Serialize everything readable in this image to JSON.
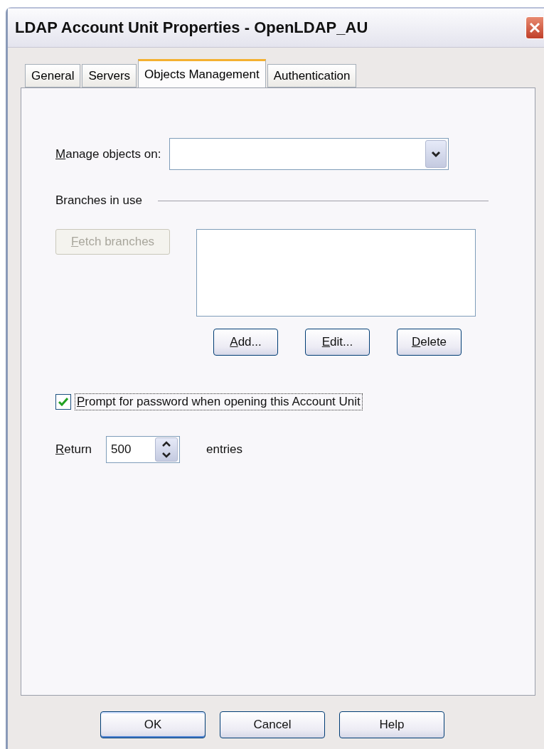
{
  "window": {
    "title": "LDAP Account Unit Properties - OpenLDAP_AU"
  },
  "tabs": [
    {
      "label": "General",
      "selected": false
    },
    {
      "label": "Servers",
      "selected": false
    },
    {
      "label": "Objects Management",
      "selected": true
    },
    {
      "label": "Authentication",
      "selected": false
    }
  ],
  "manage_objects": {
    "label": "Manage objects on:"
  },
  "branches": {
    "heading": "Branches in use",
    "fetch_button": {
      "label": "Fetch branches",
      "disabled": true
    },
    "buttons": [
      {
        "label": "Add..."
      },
      {
        "label": "Edit..."
      },
      {
        "label": "Delete"
      }
    ]
  },
  "prompt_password": {
    "label": "Prompt for password when opening this Account Unit",
    "checked": true
  },
  "return": {
    "label": "Return",
    "value": "500",
    "suffix": "entries"
  },
  "footer_buttons": [
    {
      "label": "OK",
      "default": true
    },
    {
      "label": "Cancel",
      "default": false
    },
    {
      "label": "Help",
      "default": false
    }
  ]
}
